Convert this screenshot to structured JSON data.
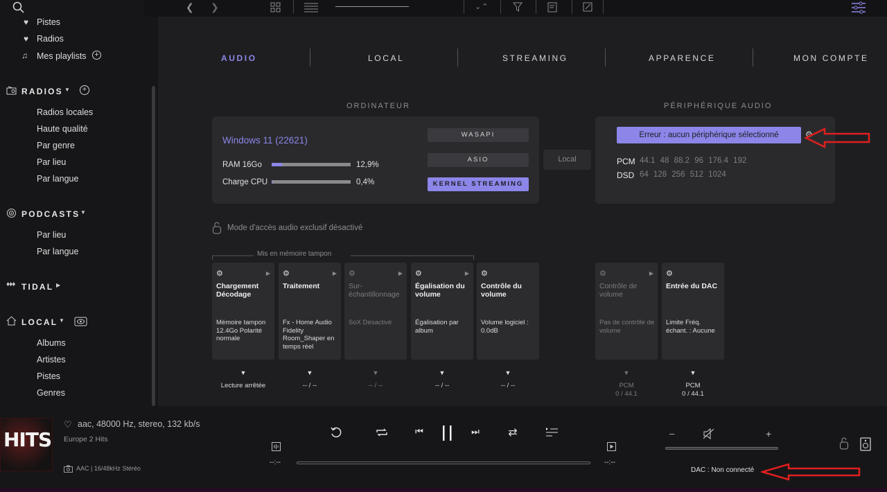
{
  "sidebar": {
    "items_top": [
      "Pistes",
      "Radios",
      "Mes playlists"
    ],
    "radios_label": "RADIOS",
    "radios_items": [
      "Radios locales",
      "Haute qualité",
      "Par genre",
      "Par lieu",
      "Par langue"
    ],
    "podcasts_label": "PODCASTS",
    "podcasts_items": [
      "Par lieu",
      "Par langue"
    ],
    "tidal_label": "TIDAL",
    "local_label": "LOCAL",
    "local_items": [
      "Albums",
      "Artistes",
      "Pistes",
      "Genres"
    ]
  },
  "tabs": [
    "AUDIO",
    "LOCAL",
    "STREAMING",
    "APPARENCE",
    "MON COMPTE"
  ],
  "computer": {
    "section": "ORDINATEUR",
    "os": "Windows 11 (22621)",
    "ram_label": "RAM 16Go",
    "ram_value": "12,9%",
    "ram_fraction": 0.129,
    "cpu_label": "Charge CPU",
    "cpu_value": "0,4%",
    "cpu_fraction": 0.004,
    "modes": [
      "WASAPI",
      "ASIO",
      "KERNEL STREAMING"
    ],
    "local_button": "Local"
  },
  "device": {
    "section": "PÉRIPHÉRIQUE AUDIO",
    "error_button": "Erreur : aucun périphérique sélectionné",
    "pcm_label": "PCM",
    "pcm_rates": [
      "44.1",
      "48",
      "88.2",
      "96",
      "176.4",
      "192"
    ],
    "dsd_label": "DSD",
    "dsd_rates": [
      "64",
      "128",
      "256",
      "512",
      "1024"
    ]
  },
  "exclusive_mode": "Mode d'accès audio exclusif désactivé",
  "buffer_label": "Mis en mémoire tampon",
  "pipeline": [
    {
      "title": "Chargement Décodage",
      "desc": "Mémoire tampon 12.4Go Polarité normale",
      "status": "Lecture arrêtée",
      "dim": false
    },
    {
      "title": "Traitement",
      "desc": "Fx - Home Audio Fidelity Room_Shaper en temps réel",
      "status": "-- / --",
      "dim": false
    },
    {
      "title": "Sur-échantillonnage",
      "desc": "SoX Désactivé",
      "status": "-- / --",
      "dim": true
    },
    {
      "title": "Égalisation du volume",
      "desc": "Égalisation par album",
      "status": "-- / --",
      "dim": false
    },
    {
      "title": "Contrôle du volume",
      "desc": "Volume logiciel : 0.0dB",
      "status": "-- / --",
      "dim": false
    },
    {
      "title": "Contrôle de volume",
      "desc": "Pas de contrôle de volume",
      "status": "PCM",
      "status2": "0 / 44.1",
      "dim": true
    },
    {
      "title": "Entrée du DAC",
      "desc": "Limite Fréq. échant. : Aucune",
      "status": "PCM",
      "status2": "0 / 44.1",
      "dim": false
    }
  ],
  "player": {
    "cover_text": "HITS",
    "format": "aac, 48000 Hz, stereo, 132 kb/s",
    "station": "Europe 2 Hits",
    "codec": "AAC | 16/48kHz Stéréo",
    "time_left": "--:--",
    "time_right": "--:--",
    "dac_status": "DAC : Non connecté",
    "minus": "–",
    "plus": "+"
  },
  "colors": {
    "accent": "#8b86e8",
    "arrow": "#e01f1f"
  }
}
